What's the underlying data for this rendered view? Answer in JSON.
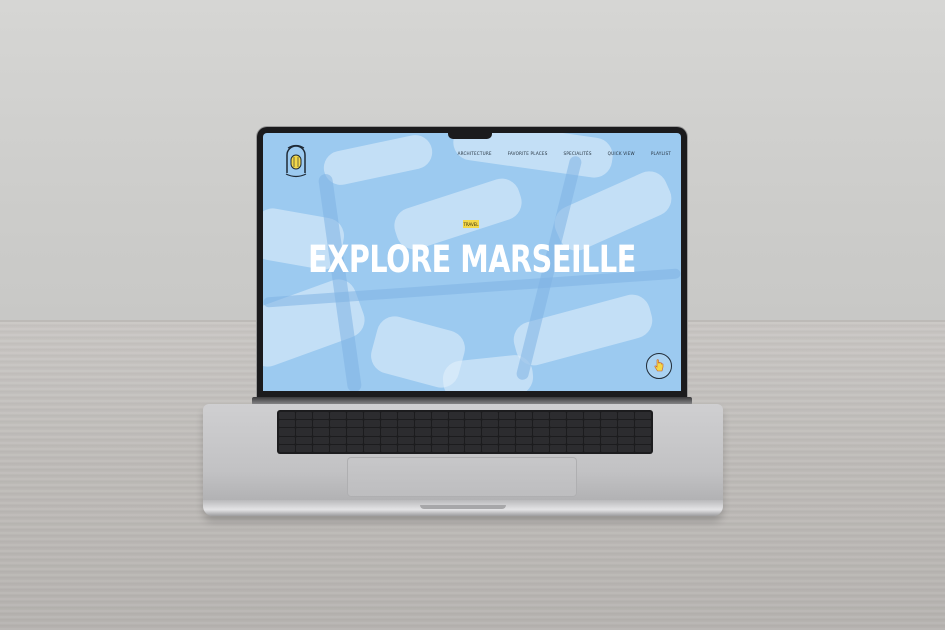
{
  "site": {
    "nav": [
      "ARCHITECTURE",
      "FAVORITE PLACES",
      "SPECIALITÉS",
      "QUICK VIEW",
      "PLAYLIST"
    ],
    "tag": "TRAVEL",
    "headline": "EXPLORE MARSEILLE",
    "logo_icon": "marseille-badge-logo",
    "sound_icon": "cursor-hand-icon"
  },
  "colors": {
    "screen_bg": "#9ccaf0",
    "tag_bg": "#f3d84a",
    "headline": "#ffffff"
  }
}
